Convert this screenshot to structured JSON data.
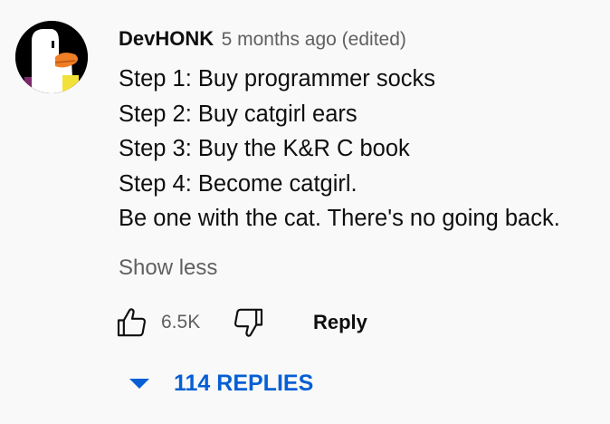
{
  "comment": {
    "author": "DevHONK",
    "meta": "5 months ago (edited)",
    "lines": [
      "Step 1: Buy programmer socks",
      "Step 2: Buy catgirl ears",
      "Step 3: Buy the K&R C book",
      "Step 4: Become catgirl.",
      "Be one with the cat. There's no going back."
    ],
    "show_less_label": "Show less"
  },
  "actions": {
    "like_icon": "thumbs-up-icon",
    "like_count": "6.5K",
    "dislike_icon": "thumbs-down-icon",
    "reply_label": "Reply"
  },
  "replies": {
    "icon": "caret-down-icon",
    "label": "114 REPLIES",
    "color": "#065fd4"
  },
  "colors": {
    "background": "#f9f9f9",
    "text_primary": "#0f0f0f",
    "text_secondary": "#606060",
    "accent": "#065fd4"
  }
}
